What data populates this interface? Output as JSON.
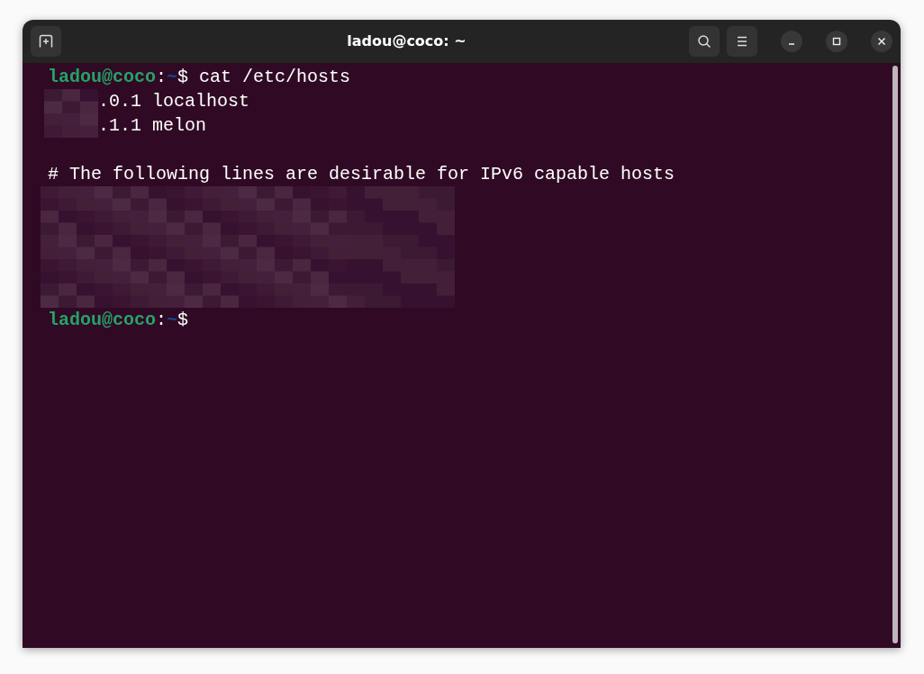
{
  "window": {
    "title": "ladou@coco: ~"
  },
  "terminal": {
    "lines": [
      {
        "kind": "prompt",
        "user": "ladou@coco",
        "separator": ":",
        "path": "~",
        "symbol": "$",
        "command": "cat /etc/hosts"
      },
      {
        "kind": "output",
        "redacted_prefix": true,
        "text": ".0.1 localhost"
      },
      {
        "kind": "output",
        "redacted_prefix": true,
        "text": ".1.1 melon"
      },
      {
        "kind": "blank"
      },
      {
        "kind": "output",
        "redacted_prefix": false,
        "text": "# The following lines are desirable for IPv6 capable hosts"
      },
      {
        "kind": "redacted"
      },
      {
        "kind": "redacted"
      },
      {
        "kind": "redacted"
      },
      {
        "kind": "redacted"
      },
      {
        "kind": "redacted"
      },
      {
        "kind": "prompt",
        "user": "ladou@coco",
        "separator": ":",
        "path": "~",
        "symbol": "$"
      }
    ]
  }
}
